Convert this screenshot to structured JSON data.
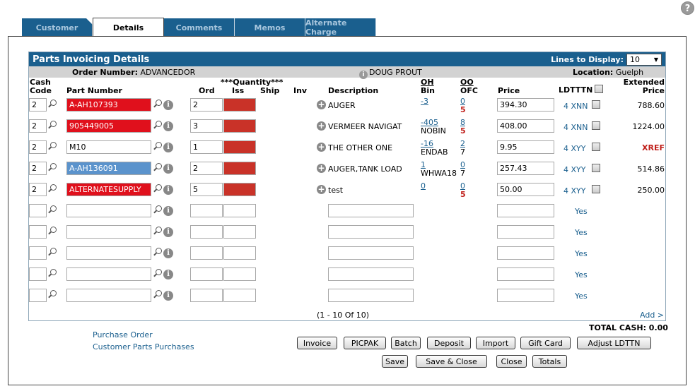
{
  "help_icon": "?",
  "tabs": [
    {
      "label": "Customer"
    },
    {
      "label": "Details"
    },
    {
      "label": "Comments"
    },
    {
      "label": "Memos"
    },
    {
      "label": "Alternate Charge"
    }
  ],
  "panel": {
    "title": "Parts Invoicing Details",
    "lines_label": "Lines to Display:",
    "lines_value": "10"
  },
  "info": {
    "order_label": "Order Number:",
    "order_value": "ADVANCEDOR",
    "salesperson": "DOUG PROUT",
    "location_label": "Location:",
    "location_value": "Guelph"
  },
  "headers": {
    "cash": "Cash",
    "code": "Code",
    "part_number": "Part Number",
    "quantity": "***Quantity***",
    "ord": "Ord",
    "iss": "Iss",
    "ship": "Ship",
    "inv": "Inv",
    "description": "Description",
    "oh": "OH",
    "bin": "Bin",
    "oo": "OO",
    "ofc": "OFC",
    "price": "Price",
    "ldtttn": "LDTTTN",
    "extended": "Extended",
    "ext_price": "Price"
  },
  "rows": [
    {
      "cash": "2",
      "part": "A-AH107393",
      "ord": "2",
      "desc": "AUGER",
      "oh": "-3",
      "bin": "",
      "oo": "0",
      "ofc": "5",
      "price": "394.30",
      "ld": "4 XNN",
      "ext": "788.60"
    },
    {
      "cash": "2",
      "part": "905449005",
      "ord": "3",
      "desc": "VERMEER NAVIGAT",
      "oh": "-405",
      "bin": "NOBIN",
      "oo": "8",
      "ofc": "5",
      "price": "408.00",
      "ld": "4 XNN",
      "ext": "1224.00"
    },
    {
      "cash": "2",
      "part": "M10",
      "ord": "1",
      "desc": "THE OTHER ONE",
      "oh": "-16",
      "bin": "ENDAB",
      "oo": "2",
      "ofc": "7",
      "price": "9.95",
      "ld": "4 XYY",
      "ext": "XREF"
    },
    {
      "cash": "2",
      "part": "A-AH136091",
      "ord": "2",
      "desc": "AUGER,TANK LOAD",
      "oh": "1",
      "bin": "WHWA18",
      "oo": "0",
      "ofc": "7",
      "price": "257.43",
      "ld": "4 XYY",
      "ext": "514.86"
    },
    {
      "cash": "2",
      "part": "ALTERNATESUPPLY",
      "ord": "5",
      "desc": "test",
      "oh": "0",
      "bin": "",
      "oo": "0",
      "ofc": "5",
      "price": "50.00",
      "ld": "4 XYY",
      "ext": "250.00"
    }
  ],
  "empty_rows": [
    {
      "yes": "Yes"
    },
    {
      "yes": "Yes"
    },
    {
      "yes": "Yes"
    },
    {
      "yes": "Yes"
    },
    {
      "yes": "Yes"
    }
  ],
  "pager": "(1  - 10  Of 10)",
  "add_link": "Add >",
  "total_cash": "TOTAL CASH:  0.00",
  "links": {
    "purchase_order": "Purchase Order",
    "customer_parts": "Customer Parts Purchases"
  },
  "buttons_row1": [
    "Invoice",
    "PICPAK",
    "Batch",
    "Deposit",
    "Import",
    "Gift Card",
    "Adjust LDTTN"
  ],
  "buttons_row2": [
    "Save",
    "Save & Close",
    "Close",
    "Totals"
  ],
  "colors": {
    "tab_blue": "#1a5f8e",
    "red_field": "#e0101c",
    "blue_field": "#5b93cc",
    "qty_red": "#c93228"
  }
}
